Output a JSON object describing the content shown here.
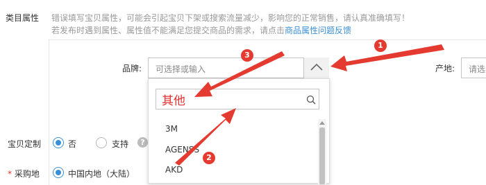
{
  "category_attrs": {
    "label": "类目属性",
    "warning_line1": "错误填写宝贝属性，可能会引起宝贝下架或搜索流量减少，影响您的正常销售，请认真准确填写！",
    "warning_line2_prefix": "若发布时遇到属性、属性值不能满足您提交商品的需求，请点击",
    "warning_link": "商品属性问题反馈"
  },
  "brand": {
    "label": "品牌:",
    "placeholder": "可选择或输入",
    "search_value": "其他",
    "options": [
      "3M",
      "AGENSS",
      "AKD"
    ]
  },
  "origin": {
    "label": "产地:",
    "placeholder": "请选"
  },
  "customization": {
    "label": "宝贝定制",
    "options": [
      {
        "label": "否",
        "selected": true
      },
      {
        "label": "支持",
        "selected": false
      }
    ]
  },
  "purchase_location": {
    "required_mark": "*",
    "label": "采购地",
    "selected_option": "中国内地（大陆）"
  },
  "annotations": {
    "badges": [
      "1",
      "2",
      "3"
    ],
    "color": "#e53a30"
  },
  "colors": {
    "accent": "#3a8fd6",
    "highlight_text": "#e4302f"
  }
}
